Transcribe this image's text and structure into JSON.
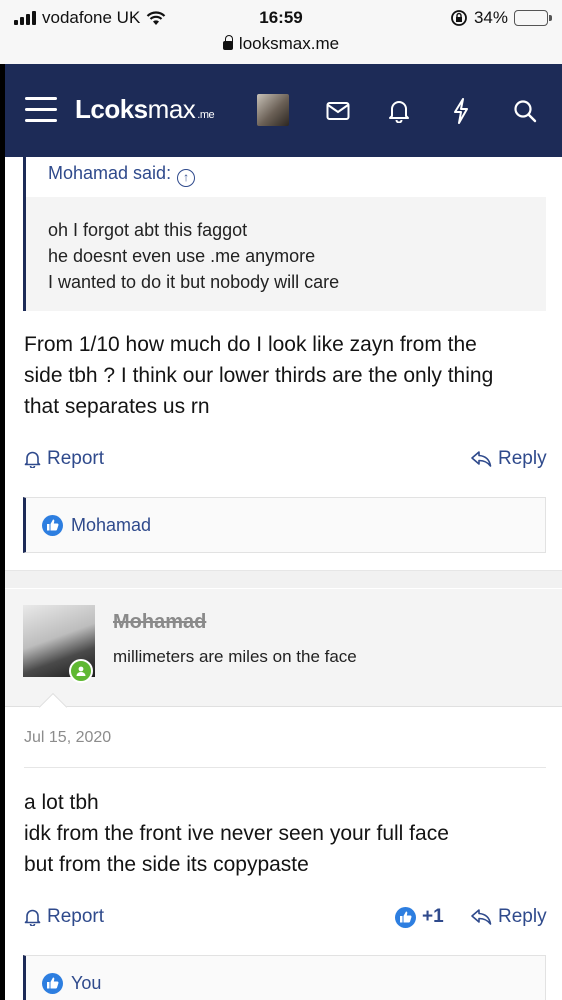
{
  "status_bar": {
    "carrier": "vodafone UK",
    "time": "16:59",
    "battery": "34%",
    "battery_level": 0.34,
    "url": "looksmax.me"
  },
  "header": {
    "logo_main": "Lcoks",
    "logo_max": "max",
    "logo_suffix": ".me",
    "icons": [
      "menu-icon",
      "avatar",
      "mail-icon",
      "bell-icon",
      "bolt-icon",
      "search-icon"
    ]
  },
  "post1": {
    "quote": {
      "author_line": "Mohamad said:",
      "lines": [
        "oh I forgot abt this faggot",
        "he doesnt even use .me anymore",
        "I wanted to do it but nobody will care"
      ]
    },
    "message_lines": [
      "From 1/10 how much do I look like zayn from the",
      "side tbh ? I think our lower thirds are the only thing",
      "that separates us rn"
    ],
    "report_label": "Report",
    "reply_label": "Reply",
    "reactions_user": "Mohamad"
  },
  "post2": {
    "username": "Mohamad",
    "user_title": "millimeters are miles on the face",
    "date": "Jul 15, 2020",
    "message_lines": [
      "a lot tbh",
      "idk from the front ive never seen your full face",
      "but from the side its copypaste"
    ],
    "report_label": "Report",
    "reply_label": "Reply",
    "like_count": "+1",
    "reactions_user": "You"
  },
  "colors": {
    "header_bg": "#1d2b57",
    "link": "#2f4a8c",
    "like_blue": "#2d7ee0",
    "online_green": "#5fb832"
  }
}
